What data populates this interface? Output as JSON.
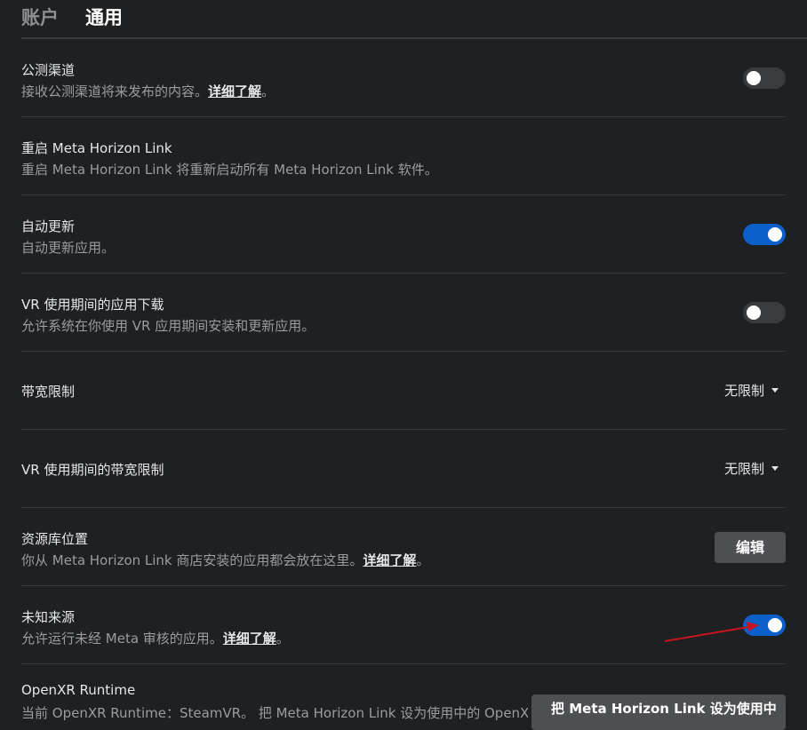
{
  "tabs": [
    {
      "label": "账户"
    },
    {
      "label": "通用"
    }
  ],
  "settings": {
    "public_channel": {
      "title": "公测渠道",
      "desc": "接收公测渠道将来发布的内容。",
      "link": "详细了解",
      "suffix": "。",
      "enabled": false
    },
    "restart_link": {
      "title": "重启 Meta Horizon Link",
      "desc": "重启 Meta Horizon Link 将重新启动所有 Meta Horizon Link 软件。"
    },
    "auto_update": {
      "title": "自动更新",
      "desc": "自动更新应用。",
      "enabled": true
    },
    "vr_download": {
      "title": "VR 使用期间的应用下载",
      "desc": "允许系统在你使用 VR 应用期间安装和更新应用。",
      "enabled": false
    },
    "bandwidth": {
      "title": "带宽限制",
      "value": "无限制"
    },
    "vr_bandwidth": {
      "title": "VR 使用期间的带宽限制",
      "value": "无限制"
    },
    "library_location": {
      "title": "资源库位置",
      "desc": "你从 Meta Horizon Link 商店安装的应用都会放在这里。",
      "link": "详细了解",
      "suffix": "。",
      "button": "编辑"
    },
    "unknown_sources": {
      "title": "未知来源",
      "desc": "允许运行未经 Meta 审核的应用。",
      "link": "详细了解",
      "suffix": "。",
      "enabled": true
    },
    "openxr": {
      "title": "OpenXR Runtime",
      "desc": "当前 OpenXR Runtime：SteamVR。 把 Meta Horizon Link 设为使用中的 OpenXR",
      "button": "把 Meta Horizon Link 设为使用中"
    }
  },
  "colors": {
    "background": "#1f2022",
    "toggle_on": "#0a5fc8",
    "toggle_off": "#3a3b3e",
    "annotation_arrow": "#c8141e"
  }
}
